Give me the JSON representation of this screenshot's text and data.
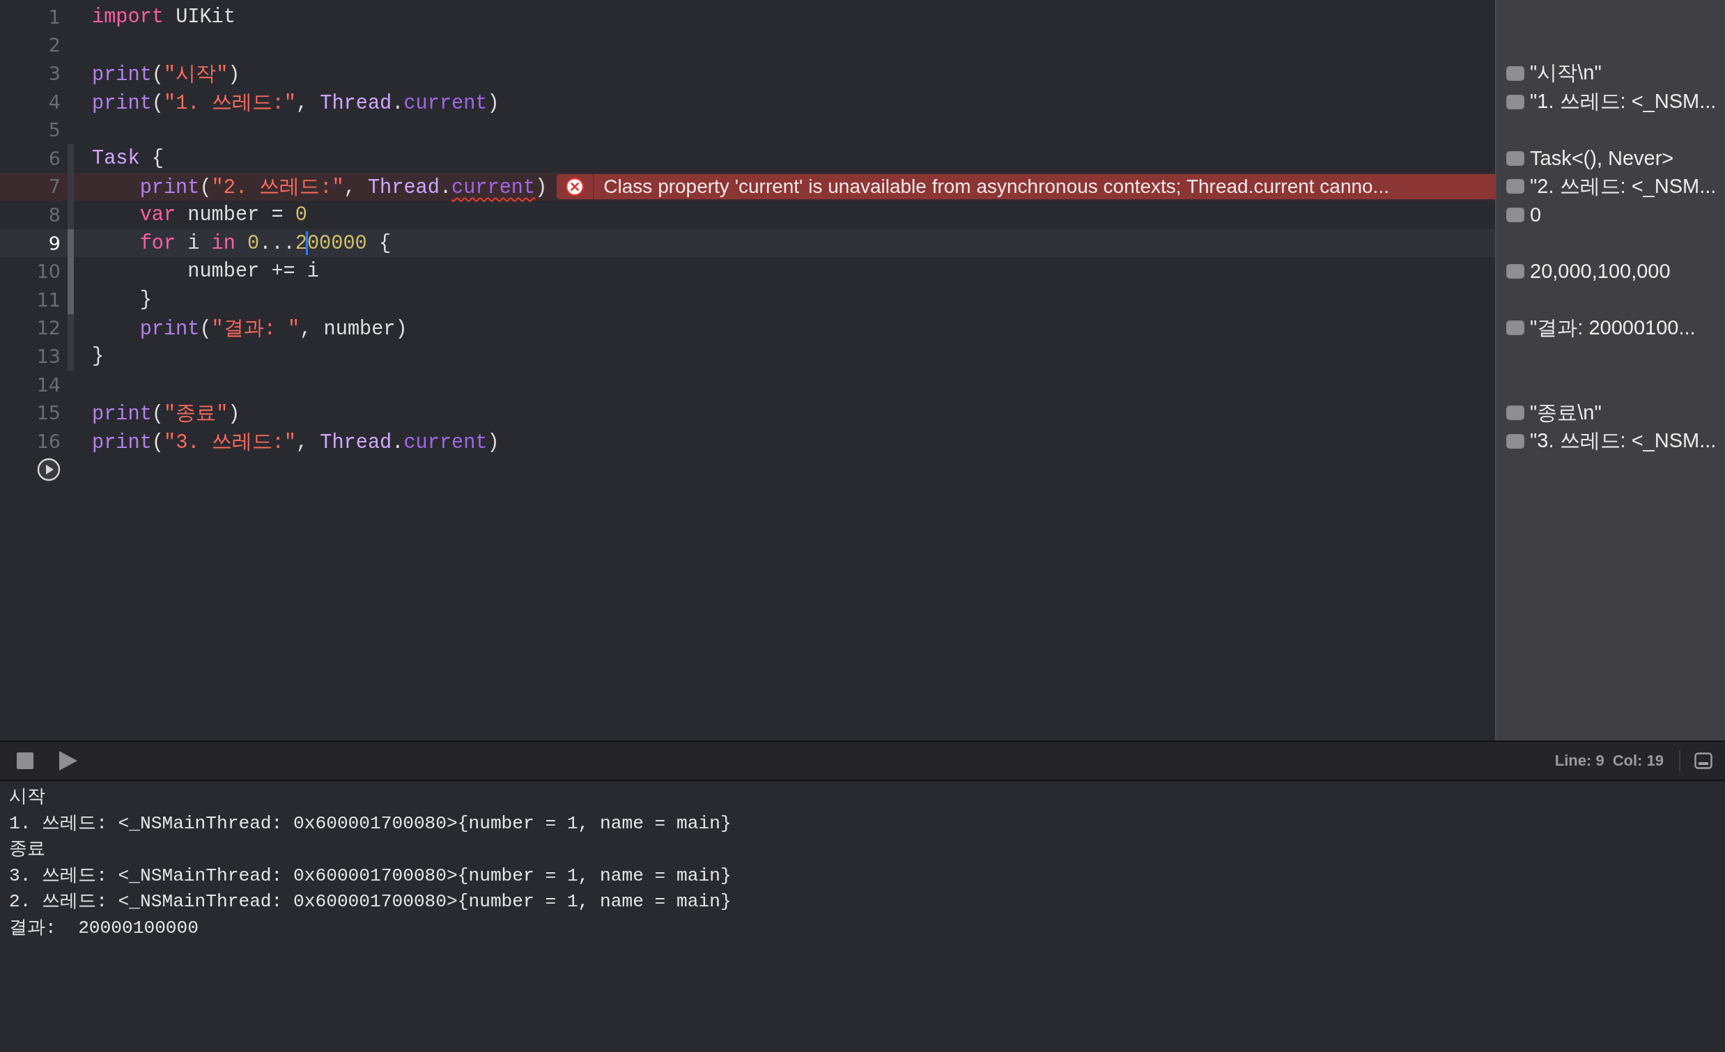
{
  "editor": {
    "lines": [
      {
        "number": "1",
        "current": false,
        "in_scope": false,
        "in_focus": false,
        "tokens": [
          {
            "kind": "keyword",
            "text": "import"
          },
          {
            "kind": "plain",
            "text": " UIKit"
          }
        ]
      },
      {
        "number": "2",
        "current": false,
        "in_scope": false,
        "in_focus": false
      },
      {
        "number": "3",
        "current": false,
        "in_scope": false,
        "in_focus": false,
        "tokens": [
          {
            "kind": "function",
            "text": "print"
          },
          {
            "kind": "plain",
            "text": "("
          },
          {
            "kind": "string",
            "text": "\"시작\""
          },
          {
            "kind": "plain",
            "text": ")"
          }
        ],
        "result": "\"시작\\n\""
      },
      {
        "number": "4",
        "current": false,
        "in_scope": false,
        "in_focus": false,
        "tokens": [
          {
            "kind": "function",
            "text": "print"
          },
          {
            "kind": "plain",
            "text": "("
          },
          {
            "kind": "string",
            "text": "\"1. 쓰레드:\""
          },
          {
            "kind": "plain",
            "text": ", "
          },
          {
            "kind": "type",
            "text": "Thread"
          },
          {
            "kind": "plain",
            "text": "."
          },
          {
            "kind": "property",
            "text": "current"
          },
          {
            "kind": "plain",
            "text": ")"
          }
        ],
        "result": "\"1. 쓰레드: <_NSM..."
      },
      {
        "number": "5",
        "current": false,
        "in_scope": false,
        "in_focus": false
      },
      {
        "number": "6",
        "current": false,
        "in_scope": true,
        "in_focus": false,
        "tokens": [
          {
            "kind": "type",
            "text": "Task"
          },
          {
            "kind": "plain",
            "text": " {"
          }
        ],
        "result": "Task<(), Never>"
      },
      {
        "number": "7",
        "current": false,
        "in_scope": true,
        "in_focus": false,
        "tokens": [
          {
            "kind": "function",
            "text": "    print"
          },
          {
            "kind": "plain",
            "text": "("
          },
          {
            "kind": "string",
            "text": "\"2. 쓰레드:\""
          },
          {
            "kind": "plain",
            "text": ", "
          },
          {
            "kind": "type",
            "text": "Thread"
          },
          {
            "kind": "plain",
            "text": "."
          },
          {
            "kind": "property",
            "text": "current",
            "error_underline": true
          },
          {
            "kind": "plain",
            "text": ")"
          }
        ],
        "error": "Class property 'current' is unavailable from asynchronous contexts; Thread.current canno...",
        "result": "\"2. 쓰레드: <_NSM..."
      },
      {
        "number": "8",
        "current": false,
        "in_scope": true,
        "in_focus": false,
        "tokens": [
          {
            "kind": "keyword",
            "text": "    var"
          },
          {
            "kind": "plain",
            "text": " number = "
          },
          {
            "kind": "number",
            "text": "0"
          }
        ],
        "result": "0"
      },
      {
        "number": "9",
        "current": true,
        "in_scope": true,
        "in_focus": true,
        "tokens": [
          {
            "kind": "keyword",
            "text": "    for"
          },
          {
            "kind": "plain",
            "text": " i "
          },
          {
            "kind": "keyword",
            "text": "in "
          },
          {
            "kind": "number",
            "text": "0"
          },
          {
            "kind": "plain",
            "text": "..."
          },
          {
            "kind": "number",
            "text": "2"
          },
          {
            "kind": "cursor"
          },
          {
            "kind": "number",
            "text": "00000"
          },
          {
            "kind": "plain",
            "text": " {"
          }
        ]
      },
      {
        "number": "10",
        "current": false,
        "in_scope": true,
        "in_focus": true,
        "tokens": [
          {
            "kind": "plain",
            "text": "        number += i"
          }
        ],
        "result": "20,000,100,000"
      },
      {
        "number": "11",
        "current": false,
        "in_scope": true,
        "in_focus": true,
        "tokens": [
          {
            "kind": "plain",
            "text": "    }"
          }
        ]
      },
      {
        "number": "12",
        "current": false,
        "in_scope": true,
        "in_focus": false,
        "tokens": [
          {
            "kind": "function",
            "text": "    print"
          },
          {
            "kind": "plain",
            "text": "("
          },
          {
            "kind": "string",
            "text": "\"결과: \""
          },
          {
            "kind": "plain",
            "text": ", number)"
          }
        ],
        "result": "\"결과:  20000100..."
      },
      {
        "number": "13",
        "current": false,
        "in_scope": true,
        "in_focus": false,
        "tokens": [
          {
            "kind": "plain",
            "text": "}"
          }
        ]
      },
      {
        "number": "14",
        "current": false,
        "in_scope": false,
        "in_focus": false
      },
      {
        "number": "15",
        "current": false,
        "in_scope": false,
        "in_focus": false,
        "tokens": [
          {
            "kind": "function",
            "text": "print"
          },
          {
            "kind": "plain",
            "text": "("
          },
          {
            "kind": "string",
            "text": "\"종료\""
          },
          {
            "kind": "plain",
            "text": ")"
          }
        ],
        "result": "\"종료\\n\""
      },
      {
        "number": "16",
        "current": false,
        "in_scope": false,
        "in_focus": false,
        "tokens": [
          {
            "kind": "function",
            "text": "print"
          },
          {
            "kind": "plain",
            "text": "("
          },
          {
            "kind": "string",
            "text": "\"3. 쓰레드:\""
          },
          {
            "kind": "plain",
            "text": ", "
          },
          {
            "kind": "type",
            "text": "Thread"
          },
          {
            "kind": "plain",
            "text": "."
          },
          {
            "kind": "property",
            "text": "current"
          },
          {
            "kind": "plain",
            "text": ")"
          }
        ],
        "result": "\"3. 쓰레드: <_NSM..."
      }
    ]
  },
  "status_bar": {
    "line": "Line: 9",
    "column": "Col: 19"
  },
  "console": {
    "lines": [
      "시작",
      "1. 쓰레드: <_NSMainThread: 0x600001700080>{number = 1, name = main}",
      "종료",
      "3. 쓰레드: <_NSMainThread: 0x600001700080>{number = 1, name = main}",
      "2. 쓰레드: <_NSMainThread: 0x600001700080>{number = 1, name = main}",
      "결과:  20000100000"
    ]
  }
}
